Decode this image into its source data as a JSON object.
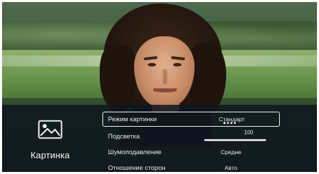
{
  "osd": {
    "category": {
      "label": "Картинка",
      "icon": "picture-icon"
    },
    "menu": [
      {
        "label": "Режим картинки",
        "value": "Стандарт",
        "selected": true,
        "page_dots": 4,
        "active_dot": 1
      },
      {
        "label": "Подсветка",
        "value": "100",
        "type": "slider",
        "level": 1.0
      },
      {
        "label": "Шумоподавление",
        "value": "Средне"
      },
      {
        "label": "Отношение сторон",
        "value": "Авто"
      }
    ]
  },
  "colors": {
    "overlay": "#0e161e",
    "highlight_border": "#f2f4f6",
    "text": "#e6e9ee"
  }
}
